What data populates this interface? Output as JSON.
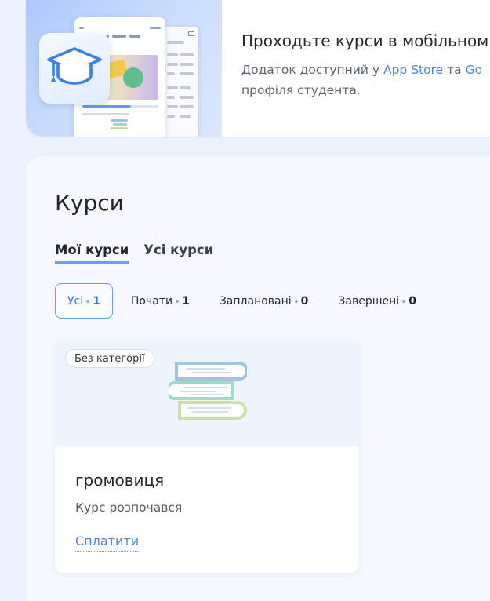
{
  "promo": {
    "title": "Проходьте курси в мобільном",
    "desc_before": "Додаток доступний у ",
    "app_store": "App Store",
    "desc_mid": " та ",
    "google_play": "Go",
    "desc_line2": "профіля студента.",
    "illustration_icon": "graduation-cap-icon"
  },
  "courses": {
    "title": "Курси",
    "tabs": [
      {
        "label": "Мої курси",
        "active": true
      },
      {
        "label": "Усі курси",
        "active": false
      }
    ],
    "filters": [
      {
        "label": "Усі",
        "count": "1",
        "active": true
      },
      {
        "label": "Почати",
        "count": "1",
        "active": false
      },
      {
        "label": "Заплановані",
        "count": "0",
        "active": false
      },
      {
        "label": "Завершені",
        "count": "0",
        "active": false
      }
    ],
    "items": [
      {
        "category": "Без категорії",
        "name": "громовиця",
        "status": "Курс розпочався",
        "action": "Сплатити",
        "cover_icon": "books-stack-icon"
      }
    ]
  },
  "colors": {
    "background": "#eaf1fd",
    "accent": "#4f86d9",
    "tab_underline": "#6e9ef0"
  }
}
